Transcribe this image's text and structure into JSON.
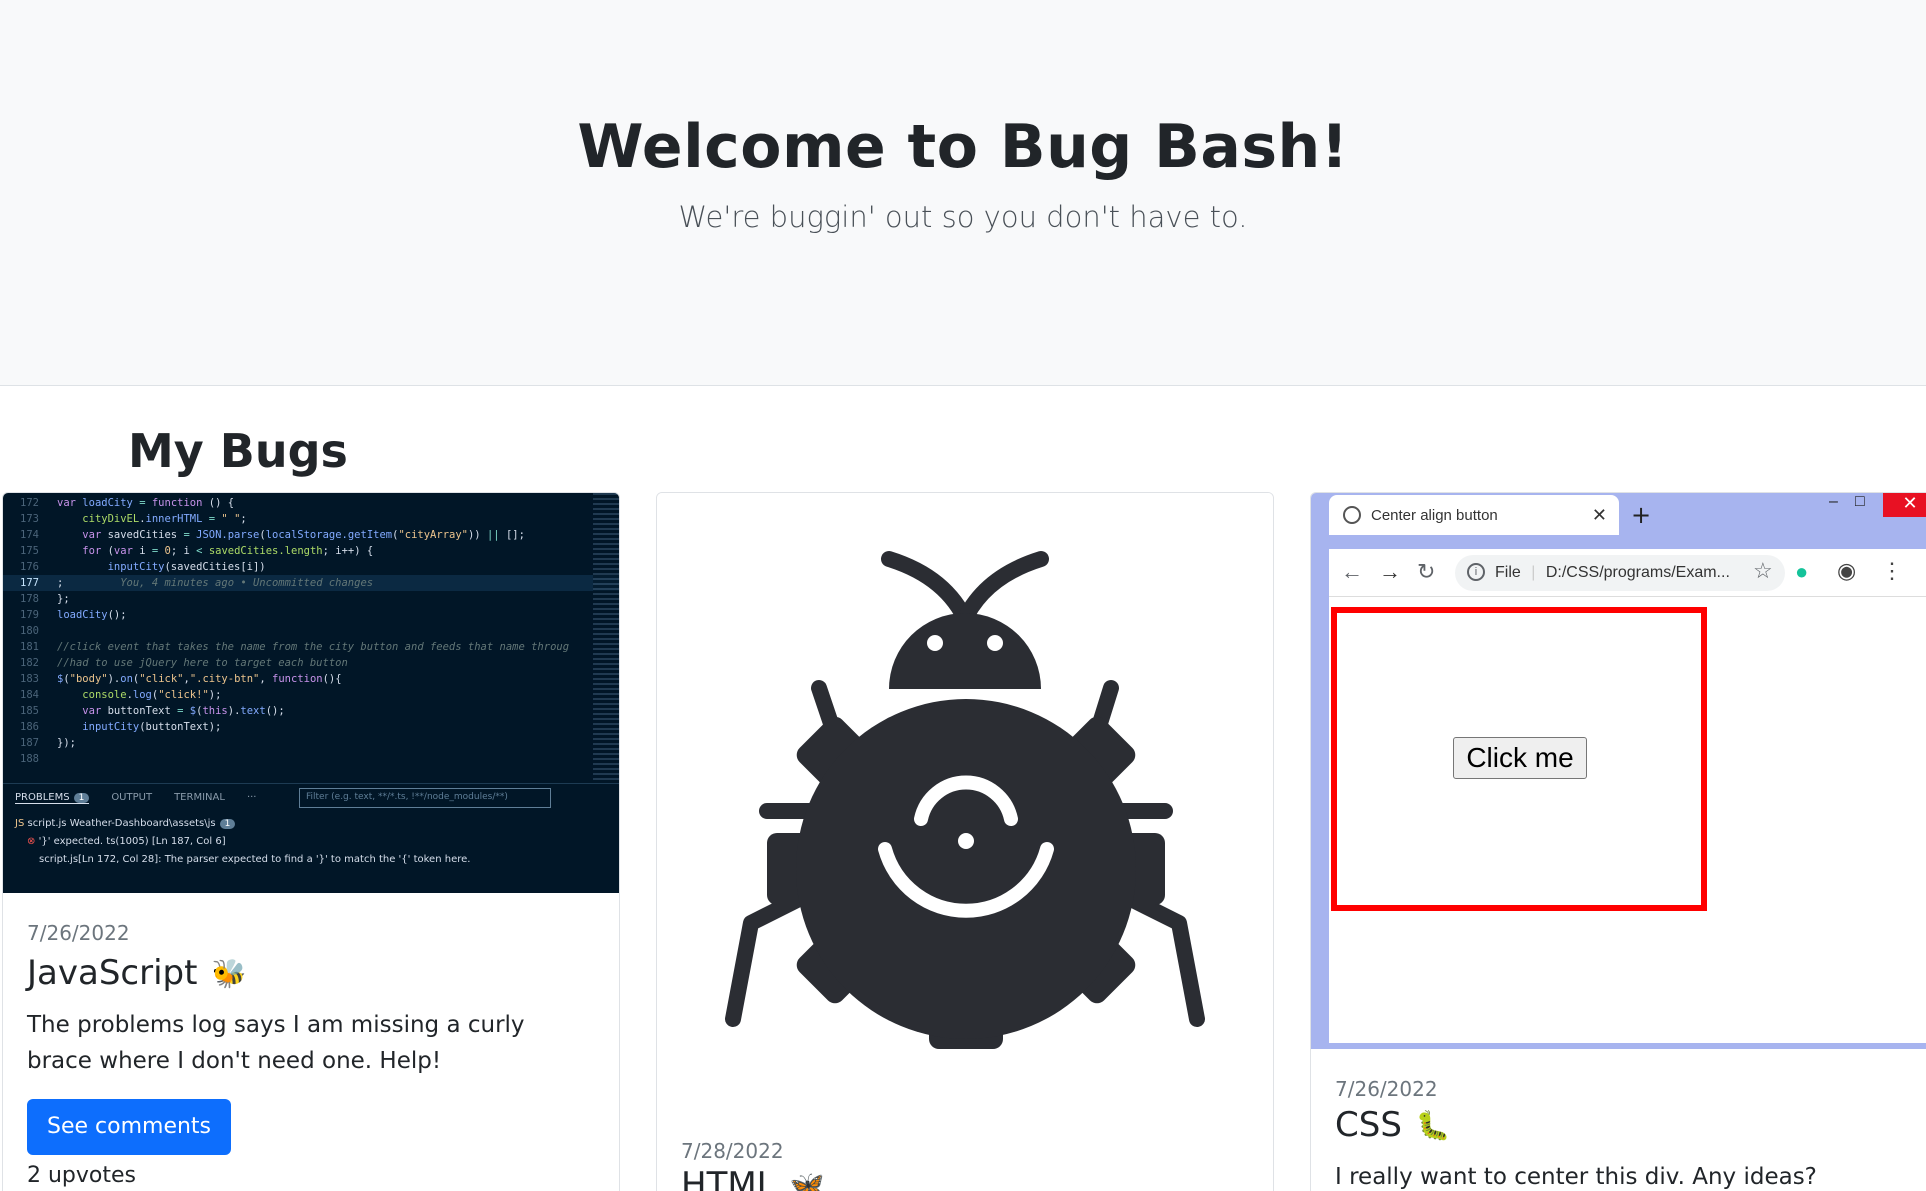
{
  "hero": {
    "title": "Welcome to Bug Bash!",
    "subtitle": "We're buggin' out so you don't have to."
  },
  "section": {
    "title": "My Bugs"
  },
  "colors": {
    "primary": "#0d6efd",
    "hero_bg": "#f8f9fa",
    "text": "#212529",
    "muted": "#6c757d",
    "icon_dark": "#2b2d33"
  },
  "cards": [
    {
      "date": "7/26/2022",
      "title": "JavaScript",
      "emoji": "🐝",
      "text": "The problems log says I am missing a curly brace where I don't need one. Help!",
      "button_label": "See comments",
      "upvotes": "2 upvotes",
      "image": {
        "icon": "code-editor-screenshot",
        "code_lines": [
          {
            "num": "172",
            "text": "var loadCity = function () {"
          },
          {
            "num": "173",
            "text": "    cityDivEL.innerHTML = \" \";"
          },
          {
            "num": "174",
            "text": "    var savedCities = JSON.parse(localStorage.getItem(\"cityArray\")) || [];"
          },
          {
            "num": "175",
            "text": "    for (var i = 0; i < savedCities.length; i++) {"
          },
          {
            "num": "176",
            "text": "        inputCity(savedCities[i])"
          },
          {
            "num": "177",
            "text": ";         You, 4 minutes ago • Uncommitted changes"
          },
          {
            "num": "178",
            "text": "};"
          },
          {
            "num": "179",
            "text": "loadCity();"
          },
          {
            "num": "180",
            "text": ""
          },
          {
            "num": "181",
            "text": "//click event that takes the name from the city button and feeds that name throug"
          },
          {
            "num": "182",
            "text": "//had to use jQuery here to target each button"
          },
          {
            "num": "183",
            "text": "$(\"body\").on(\"click\",\".city-btn\", function(){"
          },
          {
            "num": "184",
            "text": "    console.log(\"click!\");"
          },
          {
            "num": "185",
            "text": "    var buttonText = $(this).text();"
          },
          {
            "num": "186",
            "text": "    inputCity(buttonText);"
          },
          {
            "num": "187",
            "text": "});"
          },
          {
            "num": "188",
            "text": ""
          }
        ],
        "panel": {
          "tabs": [
            "PROBLEMS",
            "OUTPUT",
            "TERMINAL",
            "···"
          ],
          "problems_count": "1",
          "filter_placeholder": "Filter (e.g. text, **/*.ts, !**/node_modules/**)",
          "file_row": "script.js  Weather-Dashboard\\assets\\js",
          "file_count": "1",
          "error_row": "'}' expected.  ts(1005)  [Ln 187, Col 6]",
          "detail_row": "script.js[Ln 172, Col 28]: The parser expected to find a '}' to match the '{' token here."
        }
      }
    },
    {
      "date": "7/28/2022",
      "title": "HTML",
      "emoji": "🦋",
      "image": {
        "icon": "bug-gear-icon"
      }
    },
    {
      "date": "7/26/2022",
      "title": "CSS",
      "emoji": "🐛",
      "text": "I really want to center this div. Any ideas?",
      "image": {
        "icon": "browser-screenshot",
        "tab_title": "Center align button",
        "url": "D:/CSS/programs/Exam...",
        "url_prefix": "File",
        "button_label": "Click me"
      }
    }
  ]
}
